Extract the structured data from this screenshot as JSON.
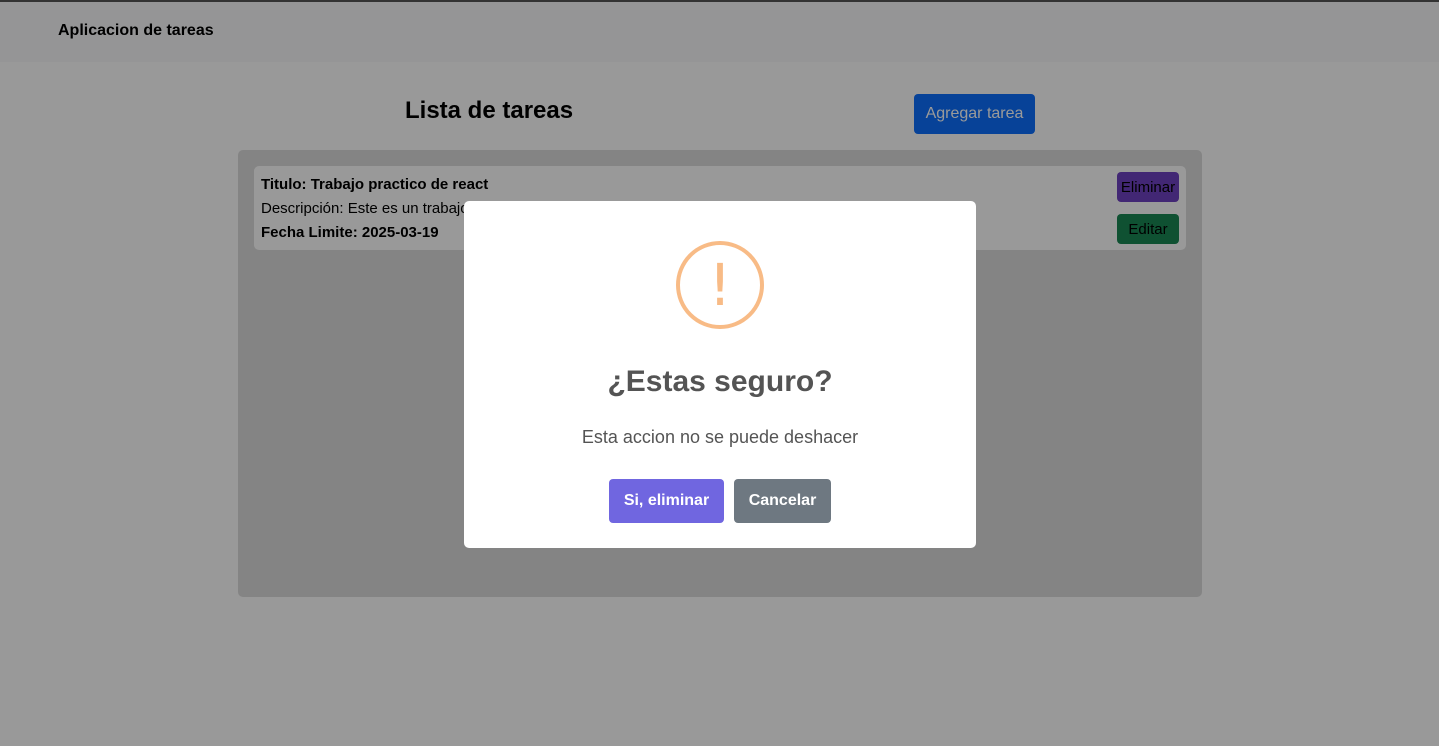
{
  "navbar": {
    "brand": "Aplicacion de tareas"
  },
  "main": {
    "title": "Lista de tareas",
    "add_button": "Agregar tarea"
  },
  "tasks": [
    {
      "title": "Titulo: Trabajo practico de react",
      "description": "Descripción: Este es un trabajo practico de react",
      "due": "Fecha Limite: 2025-03-19",
      "delete_label": "Eliminar",
      "edit_label": "Editar"
    }
  ],
  "modal": {
    "icon": "warning-icon",
    "icon_glyph": "!",
    "title": "¿Estas seguro?",
    "text": "Esta accion no se puede deshacer",
    "confirm_label": "Si, eliminar",
    "cancel_label": "Cancelar"
  },
  "colors": {
    "primary": "#0d6efd",
    "delete": "#6f42c1",
    "edit": "#198754",
    "confirm": "#7066e0",
    "cancel": "#6e7881",
    "warning": "#f8bb86"
  }
}
